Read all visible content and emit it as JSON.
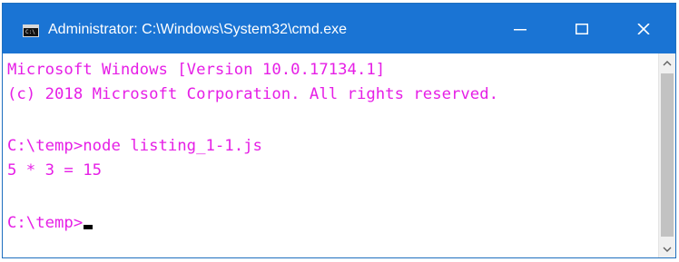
{
  "window": {
    "title": "Administrator: C:\\Windows\\System32\\cmd.exe",
    "icon_text": "C:\\",
    "controls": {
      "minimize_icon": "minimize-icon",
      "maximize_icon": "maximize-icon",
      "close_icon": "close-icon"
    }
  },
  "console": {
    "text_color": "#e61fe6",
    "background": "#ffffff",
    "lines": [
      "Microsoft Windows [Version 10.0.17134.1]",
      "(c) 2018 Microsoft Corporation. All rights reserved.",
      "",
      "C:\\temp>node listing_1-1.js",
      "5 * 3 = 15",
      "",
      "C:\\temp>"
    ]
  },
  "colors": {
    "titlebar": "#1a74d4",
    "accent_text": "#e61fe6"
  }
}
